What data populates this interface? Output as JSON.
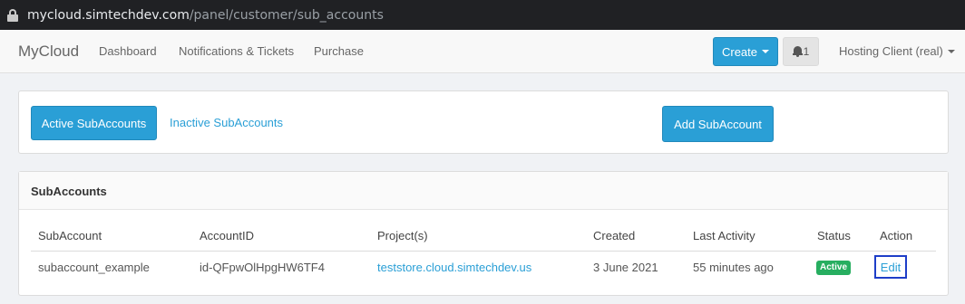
{
  "browser": {
    "url_host": "mycloud.simtechdev.com",
    "url_path": "/panel/customer/sub_accounts"
  },
  "navbar": {
    "brand": "MyCloud",
    "links": [
      "Dashboard",
      "Notifications & Tickets",
      "Purchase"
    ],
    "create_label": "Create",
    "notification_count": "1",
    "user_label": "Hosting Client (real)"
  },
  "tabs": {
    "active_label": "Active SubAccounts",
    "inactive_label": "Inactive SubAccounts",
    "add_label": "Add SubAccount"
  },
  "subaccounts": {
    "heading": "SubAccounts",
    "columns": [
      "SubAccount",
      "AccountID",
      "Project(s)",
      "Created",
      "Last Activity",
      "Status",
      "Action"
    ],
    "rows": [
      {
        "name": "subaccount_example",
        "account_id": "id-QFpwOlHpgHW6TF4",
        "project": "teststore.cloud.simtechdev.us",
        "created": "3 June 2021",
        "last_activity": "55 minutes ago",
        "status": "Active",
        "action": "Edit"
      }
    ]
  },
  "colors": {
    "accent": "#2a9fd6",
    "status_active": "#27ae60",
    "address_bar": "#202124"
  }
}
